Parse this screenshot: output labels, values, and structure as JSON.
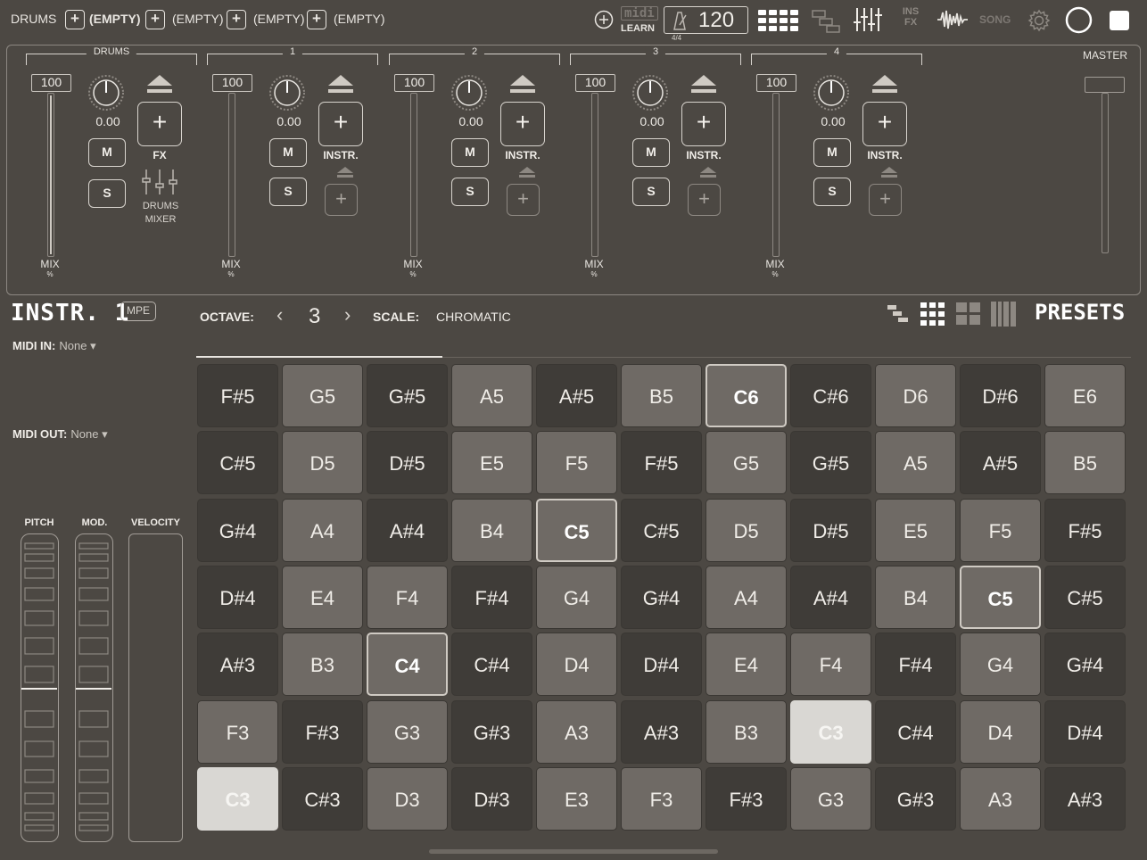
{
  "topbar": {
    "track_labels": [
      "DRUMS",
      "(EMPTY)",
      "(EMPTY)",
      "(EMPTY)",
      "(EMPTY)"
    ],
    "midi_learn_label": "LEARN",
    "midi_word": "midi",
    "tempo": "120",
    "time_signature": "4/4",
    "ins_fx_label": "INS\nFX",
    "song_label": "SONG"
  },
  "mixer": {
    "channels": [
      {
        "name": "DRUMS",
        "volume": "100",
        "pan": "0.00",
        "mute": "M",
        "solo": "S",
        "add_label": "FX",
        "extra_label": "DRUMS\nMIXER",
        "mix": "MIX",
        "mix_unit": "%"
      },
      {
        "name": "1",
        "volume": "100",
        "pan": "0.00",
        "mute": "M",
        "solo": "S",
        "add_label": "INSTR.",
        "mix": "MIX",
        "mix_unit": "%"
      },
      {
        "name": "2",
        "volume": "100",
        "pan": "0.00",
        "mute": "M",
        "solo": "S",
        "add_label": "INSTR.",
        "mix": "MIX",
        "mix_unit": "%"
      },
      {
        "name": "3",
        "volume": "100",
        "pan": "0.00",
        "mute": "M",
        "solo": "S",
        "add_label": "INSTR.",
        "mix": "MIX",
        "mix_unit": "%"
      },
      {
        "name": "4",
        "volume": "100",
        "pan": "0.00",
        "mute": "M",
        "solo": "S",
        "add_label": "INSTR.",
        "mix": "MIX",
        "mix_unit": "%"
      }
    ],
    "master_label": "MASTER",
    "plus": "+"
  },
  "instrument": {
    "title": "INSTR. 1",
    "mpe": "MPE",
    "octave_label": "OCTAVE:",
    "octave_value": "3",
    "scale_label": "SCALE:",
    "scale_value": "CHROMATIC",
    "presets": "PRESETS",
    "midi_in_label": "MIDI IN:",
    "midi_in_value": "None ▾",
    "midi_out_label": "MIDI OUT:",
    "midi_out_value": "None ▾",
    "pitch_label": "PITCH",
    "mod_label": "MOD.",
    "velocity_label": "VELOCITY"
  },
  "pads": [
    [
      "F#5",
      "G5",
      "G#5",
      "A5",
      "A#5",
      "B5",
      "C6",
      "C#6",
      "D6",
      "D#6",
      "E6"
    ],
    [
      "C#5",
      "D5",
      "D#5",
      "E5",
      "F5",
      "F#5",
      "G5",
      "G#5",
      "A5",
      "A#5",
      "B5"
    ],
    [
      "G#4",
      "A4",
      "A#4",
      "B4",
      "C5",
      "C#5",
      "D5",
      "D#5",
      "E5",
      "F5",
      "F#5"
    ],
    [
      "D#4",
      "E4",
      "F4",
      "F#4",
      "G4",
      "G#4",
      "A4",
      "A#4",
      "B4",
      "C5",
      "C#5"
    ],
    [
      "A#3",
      "B3",
      "C4",
      "C#4",
      "D4",
      "D#4",
      "E4",
      "F4",
      "F#4",
      "G4",
      "G#4"
    ],
    [
      "F3",
      "F#3",
      "G3",
      "G#3",
      "A3",
      "A#3",
      "B3",
      "C3",
      "C#4",
      "D4",
      "D#4"
    ],
    [
      "C3",
      "C#3",
      "D3",
      "D#3",
      "E3",
      "F3",
      "F#3",
      "G3",
      "G#3",
      "A3",
      "A#3"
    ]
  ],
  "colors": {
    "background": "#4c4843",
    "pad_light": "#6f6a65",
    "pad_dark": "#3f3c38",
    "pad_active": "#d9d7d3"
  }
}
